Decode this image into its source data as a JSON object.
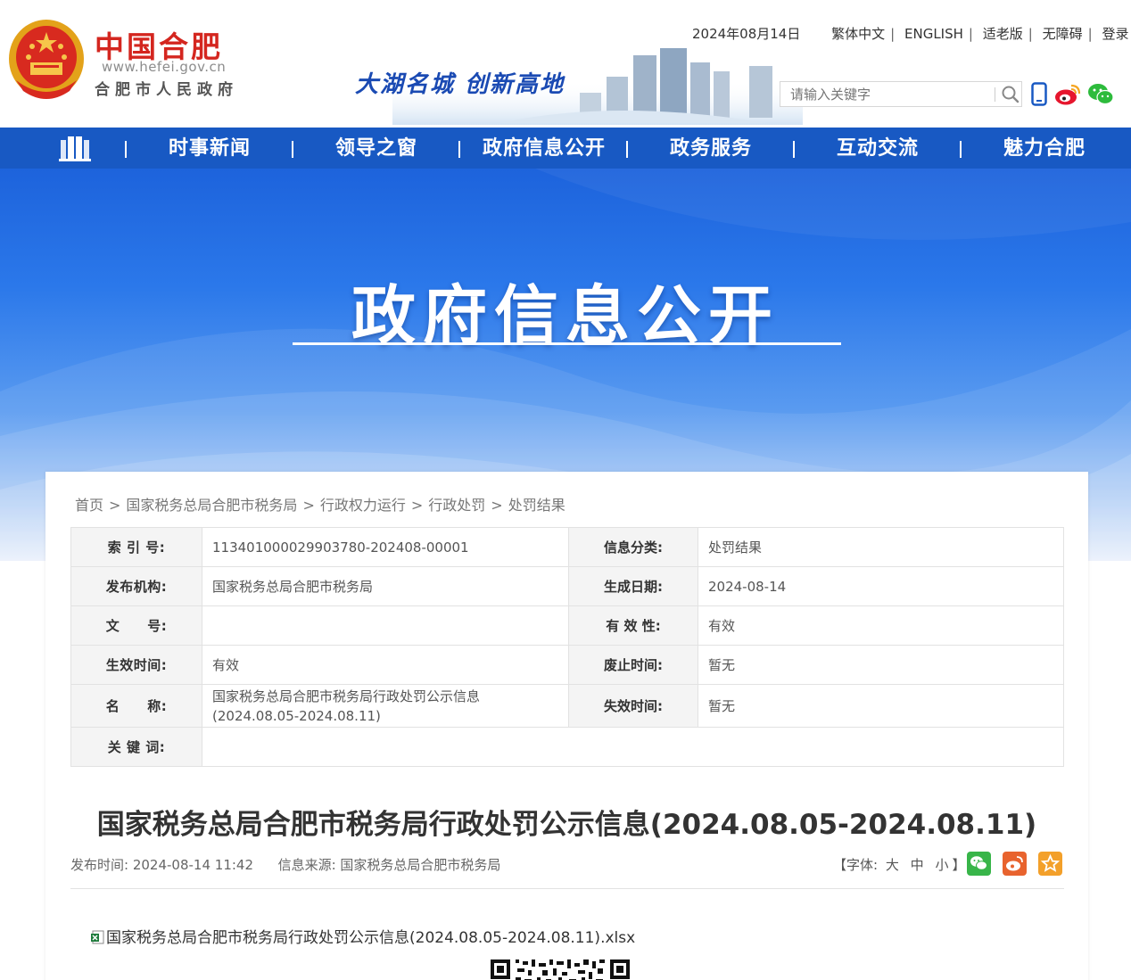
{
  "header": {
    "site_title": "中国合肥",
    "site_url": "www.hefei.gov.cn",
    "site_org": "合肥市人民政府",
    "slogan": "大湖名城 创新高地",
    "date": "2024年08月14日",
    "links": [
      "繁体中文",
      "ENGLISH",
      "适老版",
      "无障碍",
      "登录"
    ],
    "search_placeholder": "请输入关键字"
  },
  "nav": {
    "items": [
      "时事新闻",
      "领导之窗",
      "政府信息公开",
      "政务服务",
      "互动交流",
      "魅力合肥"
    ]
  },
  "banner": {
    "title": "政府信息公开"
  },
  "breadcrumb": [
    "首页",
    "国家税务总局合肥市税务局",
    "行政权力运行",
    "行政处罚",
    "处罚结果"
  ],
  "meta": {
    "index_label": "索 引 号:",
    "index_value": "113401000029903780-202408-00001",
    "category_label": "信息分类:",
    "category_value": "处罚结果",
    "publisher_label": "发布机构:",
    "publisher_value": "国家税务总局合肥市税务局",
    "created_label": "生成日期:",
    "created_value": "2024-08-14",
    "docno_label": "文　　号:",
    "docno_value": "",
    "validity_label": "有 效 性:",
    "validity_value": "有效",
    "effective_label": "生效时间:",
    "effective_value": "有效",
    "repeal_label": "废止时间:",
    "repeal_value": "暂无",
    "name_label": "名　　称:",
    "name_value": "国家税务总局合肥市税务局行政处罚公示信息(2024.08.05-2024.08.11)",
    "expire_label": "失效时间:",
    "expire_value": "暂无",
    "keywords_label": "关 键 词:",
    "keywords_value": ""
  },
  "article": {
    "title": "国家税务总局合肥市税务局行政处罚公示信息(2024.08.05-2024.08.11)",
    "publish_label": "发布时间:",
    "publish_time": "2024-08-14 11:42",
    "source_label": "信息来源:",
    "source": "国家税务总局合肥市税务局",
    "font_label": "【字体:",
    "font_large": "大",
    "font_medium": "中",
    "font_small": "小",
    "font_end": "】",
    "attachment": "国家税务总局合肥市税务局行政处罚公示信息(2024.08.05-2024.08.11).xlsx"
  },
  "colors": {
    "nav_bg": "#1859c3",
    "site_red": "#d4261f",
    "slogan_blue": "#1a4ab3"
  }
}
